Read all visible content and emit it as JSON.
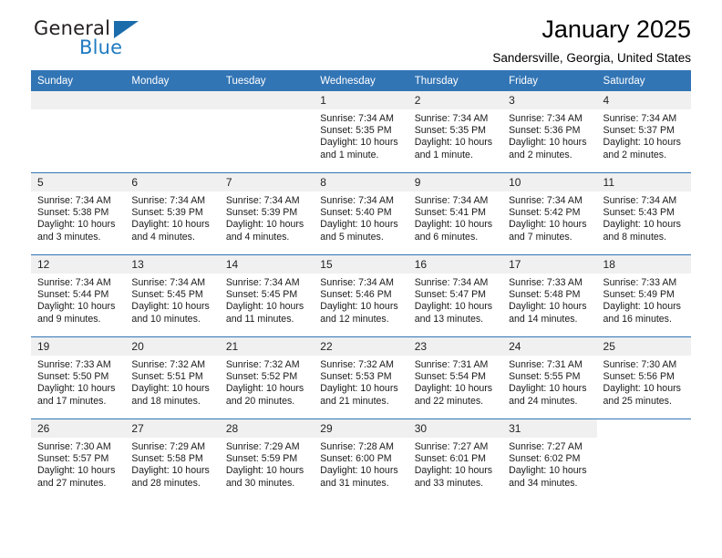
{
  "brand": {
    "name_part1": "General",
    "name_part2": "Blue",
    "triangle_color": "#1b6cab",
    "blue_color": "#1f7bc1"
  },
  "header": {
    "title": "January 2025",
    "location": "Sandersville, Georgia, United States"
  },
  "theme": {
    "header_bg": "#3275b5",
    "daynum_bg": "#f0f0f0",
    "grid_line": "#3275b5"
  },
  "weekday_headers": [
    "Sunday",
    "Monday",
    "Tuesday",
    "Wednesday",
    "Thursday",
    "Friday",
    "Saturday"
  ],
  "labels": {
    "sunrise": "Sunrise:",
    "sunset": "Sunset:",
    "daylight": "Daylight:"
  },
  "weeks": [
    [
      {
        "day": "",
        "blank": true,
        "empty_band": true,
        "sunrise": "",
        "sunset": "",
        "daylight1": "",
        "daylight2": ""
      },
      {
        "day": "",
        "blank": true,
        "empty_band": true,
        "sunrise": "",
        "sunset": "",
        "daylight1": "",
        "daylight2": ""
      },
      {
        "day": "",
        "blank": true,
        "empty_band": true,
        "sunrise": "",
        "sunset": "",
        "daylight1": "",
        "daylight2": ""
      },
      {
        "day": "1",
        "sunrise": "Sunrise: 7:34 AM",
        "sunset": "Sunset: 5:35 PM",
        "daylight1": "Daylight: 10 hours",
        "daylight2": "and 1 minute."
      },
      {
        "day": "2",
        "sunrise": "Sunrise: 7:34 AM",
        "sunset": "Sunset: 5:35 PM",
        "daylight1": "Daylight: 10 hours",
        "daylight2": "and 1 minute."
      },
      {
        "day": "3",
        "sunrise": "Sunrise: 7:34 AM",
        "sunset": "Sunset: 5:36 PM",
        "daylight1": "Daylight: 10 hours",
        "daylight2": "and 2 minutes."
      },
      {
        "day": "4",
        "sunrise": "Sunrise: 7:34 AM",
        "sunset": "Sunset: 5:37 PM",
        "daylight1": "Daylight: 10 hours",
        "daylight2": "and 2 minutes."
      }
    ],
    [
      {
        "day": "5",
        "sunrise": "Sunrise: 7:34 AM",
        "sunset": "Sunset: 5:38 PM",
        "daylight1": "Daylight: 10 hours",
        "daylight2": "and 3 minutes."
      },
      {
        "day": "6",
        "sunrise": "Sunrise: 7:34 AM",
        "sunset": "Sunset: 5:39 PM",
        "daylight1": "Daylight: 10 hours",
        "daylight2": "and 4 minutes."
      },
      {
        "day": "7",
        "sunrise": "Sunrise: 7:34 AM",
        "sunset": "Sunset: 5:39 PM",
        "daylight1": "Daylight: 10 hours",
        "daylight2": "and 4 minutes."
      },
      {
        "day": "8",
        "sunrise": "Sunrise: 7:34 AM",
        "sunset": "Sunset: 5:40 PM",
        "daylight1": "Daylight: 10 hours",
        "daylight2": "and 5 minutes."
      },
      {
        "day": "9",
        "sunrise": "Sunrise: 7:34 AM",
        "sunset": "Sunset: 5:41 PM",
        "daylight1": "Daylight: 10 hours",
        "daylight2": "and 6 minutes."
      },
      {
        "day": "10",
        "sunrise": "Sunrise: 7:34 AM",
        "sunset": "Sunset: 5:42 PM",
        "daylight1": "Daylight: 10 hours",
        "daylight2": "and 7 minutes."
      },
      {
        "day": "11",
        "sunrise": "Sunrise: 7:34 AM",
        "sunset": "Sunset: 5:43 PM",
        "daylight1": "Daylight: 10 hours",
        "daylight2": "and 8 minutes."
      }
    ],
    [
      {
        "day": "12",
        "sunrise": "Sunrise: 7:34 AM",
        "sunset": "Sunset: 5:44 PM",
        "daylight1": "Daylight: 10 hours",
        "daylight2": "and 9 minutes."
      },
      {
        "day": "13",
        "sunrise": "Sunrise: 7:34 AM",
        "sunset": "Sunset: 5:45 PM",
        "daylight1": "Daylight: 10 hours",
        "daylight2": "and 10 minutes."
      },
      {
        "day": "14",
        "sunrise": "Sunrise: 7:34 AM",
        "sunset": "Sunset: 5:45 PM",
        "daylight1": "Daylight: 10 hours",
        "daylight2": "and 11 minutes."
      },
      {
        "day": "15",
        "sunrise": "Sunrise: 7:34 AM",
        "sunset": "Sunset: 5:46 PM",
        "daylight1": "Daylight: 10 hours",
        "daylight2": "and 12 minutes."
      },
      {
        "day": "16",
        "sunrise": "Sunrise: 7:34 AM",
        "sunset": "Sunset: 5:47 PM",
        "daylight1": "Daylight: 10 hours",
        "daylight2": "and 13 minutes."
      },
      {
        "day": "17",
        "sunrise": "Sunrise: 7:33 AM",
        "sunset": "Sunset: 5:48 PM",
        "daylight1": "Daylight: 10 hours",
        "daylight2": "and 14 minutes."
      },
      {
        "day": "18",
        "sunrise": "Sunrise: 7:33 AM",
        "sunset": "Sunset: 5:49 PM",
        "daylight1": "Daylight: 10 hours",
        "daylight2": "and 16 minutes."
      }
    ],
    [
      {
        "day": "19",
        "sunrise": "Sunrise: 7:33 AM",
        "sunset": "Sunset: 5:50 PM",
        "daylight1": "Daylight: 10 hours",
        "daylight2": "and 17 minutes."
      },
      {
        "day": "20",
        "sunrise": "Sunrise: 7:32 AM",
        "sunset": "Sunset: 5:51 PM",
        "daylight1": "Daylight: 10 hours",
        "daylight2": "and 18 minutes."
      },
      {
        "day": "21",
        "sunrise": "Sunrise: 7:32 AM",
        "sunset": "Sunset: 5:52 PM",
        "daylight1": "Daylight: 10 hours",
        "daylight2": "and 20 minutes."
      },
      {
        "day": "22",
        "sunrise": "Sunrise: 7:32 AM",
        "sunset": "Sunset: 5:53 PM",
        "daylight1": "Daylight: 10 hours",
        "daylight2": "and 21 minutes."
      },
      {
        "day": "23",
        "sunrise": "Sunrise: 7:31 AM",
        "sunset": "Sunset: 5:54 PM",
        "daylight1": "Daylight: 10 hours",
        "daylight2": "and 22 minutes."
      },
      {
        "day": "24",
        "sunrise": "Sunrise: 7:31 AM",
        "sunset": "Sunset: 5:55 PM",
        "daylight1": "Daylight: 10 hours",
        "daylight2": "and 24 minutes."
      },
      {
        "day": "25",
        "sunrise": "Sunrise: 7:30 AM",
        "sunset": "Sunset: 5:56 PM",
        "daylight1": "Daylight: 10 hours",
        "daylight2": "and 25 minutes."
      }
    ],
    [
      {
        "day": "26",
        "sunrise": "Sunrise: 7:30 AM",
        "sunset": "Sunset: 5:57 PM",
        "daylight1": "Daylight: 10 hours",
        "daylight2": "and 27 minutes."
      },
      {
        "day": "27",
        "sunrise": "Sunrise: 7:29 AM",
        "sunset": "Sunset: 5:58 PM",
        "daylight1": "Daylight: 10 hours",
        "daylight2": "and 28 minutes."
      },
      {
        "day": "28",
        "sunrise": "Sunrise: 7:29 AM",
        "sunset": "Sunset: 5:59 PM",
        "daylight1": "Daylight: 10 hours",
        "daylight2": "and 30 minutes."
      },
      {
        "day": "29",
        "sunrise": "Sunrise: 7:28 AM",
        "sunset": "Sunset: 6:00 PM",
        "daylight1": "Daylight: 10 hours",
        "daylight2": "and 31 minutes."
      },
      {
        "day": "30",
        "sunrise": "Sunrise: 7:27 AM",
        "sunset": "Sunset: 6:01 PM",
        "daylight1": "Daylight: 10 hours",
        "daylight2": "and 33 minutes."
      },
      {
        "day": "31",
        "sunrise": "Sunrise: 7:27 AM",
        "sunset": "Sunset: 6:02 PM",
        "daylight1": "Daylight: 10 hours",
        "daylight2": "and 34 minutes."
      },
      {
        "day": "",
        "blank": true,
        "sunrise": "",
        "sunset": "",
        "daylight1": "",
        "daylight2": ""
      }
    ]
  ]
}
